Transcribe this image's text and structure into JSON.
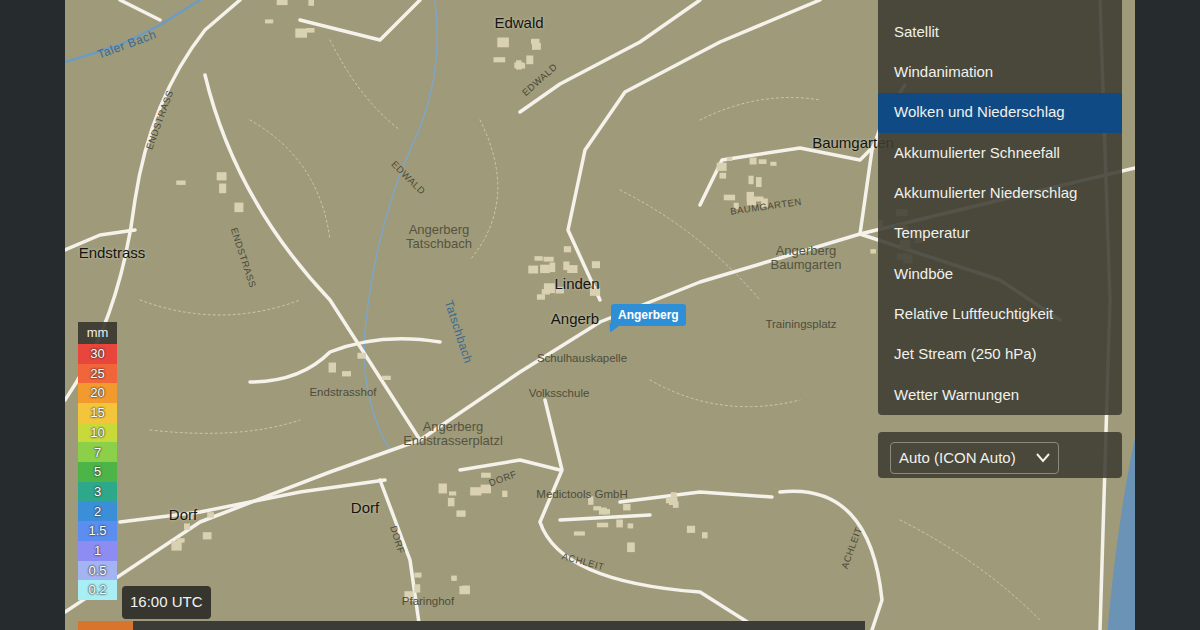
{
  "map": {
    "labels": [
      {
        "text": "Edwald",
        "kind": "place"
      },
      {
        "text": "EDWALD",
        "kind": "road"
      },
      {
        "text": "EDWALD",
        "kind": "road"
      },
      {
        "text": "Taler Bach",
        "kind": "water"
      },
      {
        "text": "ENDSTRASS",
        "kind": "road"
      },
      {
        "text": "ENDSTRASS",
        "kind": "road"
      },
      {
        "text": "Endstrass",
        "kind": "place"
      },
      {
        "text": "Baumgarten",
        "kind": "place"
      },
      {
        "text": "BAUMGARTEN",
        "kind": "road"
      },
      {
        "text": "Angerberg Tatschbach",
        "kind": "area"
      },
      {
        "text": "Angerberg Baumgarten",
        "kind": "area"
      },
      {
        "text": "Linden",
        "kind": "place"
      },
      {
        "text": "Angerb",
        "kind": "place"
      },
      {
        "text": "Trainingsplatz",
        "kind": "poi"
      },
      {
        "text": "Schulhauskapelle",
        "kind": "poi"
      },
      {
        "text": "Volksschule",
        "kind": "poi"
      },
      {
        "text": "Tatschbach",
        "kind": "water"
      },
      {
        "text": "Endstrasshof",
        "kind": "poi"
      },
      {
        "text": "Angerberg Endstrasserplatzl",
        "kind": "area"
      },
      {
        "text": "DORF",
        "kind": "road"
      },
      {
        "text": "Medictools GmbH",
        "kind": "poi"
      },
      {
        "text": "Dorf",
        "kind": "place"
      },
      {
        "text": "Dorf",
        "kind": "place"
      },
      {
        "text": "DORF",
        "kind": "road"
      },
      {
        "text": "ACHLEIT",
        "kind": "road"
      },
      {
        "text": "ACHLEIT",
        "kind": "road"
      },
      {
        "text": "Pfaringhof",
        "kind": "poi"
      }
    ]
  },
  "pin": {
    "label": "Angerberg"
  },
  "layers": {
    "items": [
      {
        "label": "Satellit",
        "selected": false
      },
      {
        "label": "Windanimation",
        "selected": false
      },
      {
        "label": "Wolken und Niederschlag",
        "selected": true
      },
      {
        "label": "Akkumulierter Schneefall",
        "selected": false
      },
      {
        "label": "Akkumulierter Niederschlag",
        "selected": false
      },
      {
        "label": "Temperatur",
        "selected": false
      },
      {
        "label": "Windböe",
        "selected": false
      },
      {
        "label": "Relative Luftfeuchtigkeit",
        "selected": false
      },
      {
        "label": "Jet Stream (250 hPa)",
        "selected": false
      },
      {
        "label": "Wetter Warnungen",
        "selected": false
      }
    ]
  },
  "model": {
    "label": "Auto (ICON Auto)"
  },
  "legend": {
    "unit": "mm",
    "steps": [
      {
        "value": "30",
        "color": "#e8453c"
      },
      {
        "value": "25",
        "color": "#f0653a"
      },
      {
        "value": "20",
        "color": "#f39a2e"
      },
      {
        "value": "15",
        "color": "#f2c53a"
      },
      {
        "value": "10",
        "color": "#c7da3a"
      },
      {
        "value": "7",
        "color": "#8ccf48"
      },
      {
        "value": "5",
        "color": "#4db548"
      },
      {
        "value": "3",
        "color": "#2ea88a"
      },
      {
        "value": "2",
        "color": "#3b8fd9"
      },
      {
        "value": "1.5",
        "color": "#5b8ef0"
      },
      {
        "value": "1",
        "color": "#8c8cf2"
      },
      {
        "value": "0.5",
        "color": "#a4b4f3"
      },
      {
        "value": "0.2",
        "color": "#a8eef4"
      }
    ]
  },
  "time": "16:00 UTC",
  "timeline": {
    "level": 0.07
  }
}
